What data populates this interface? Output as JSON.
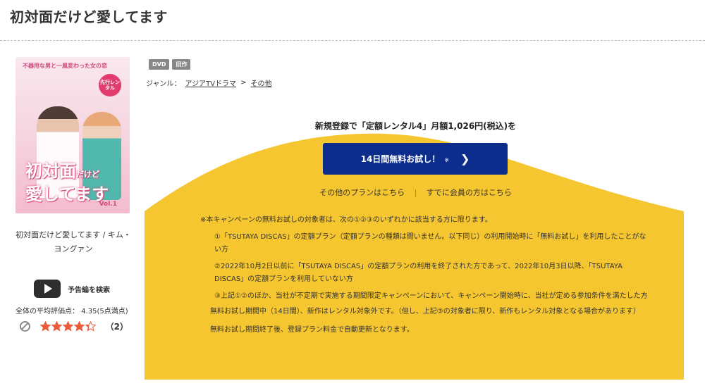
{
  "page": {
    "title": "初対面だけど愛してます"
  },
  "poster": {
    "top_text": "不器用な男と一風変わった女の恋",
    "badge": "先行レンタル",
    "title_line1": "初対面",
    "title_small": "だけど",
    "title_line2": "愛してます",
    "vol": "Vol.1"
  },
  "item": {
    "caption": "初対面だけど愛してます / キム・ヨングァン",
    "trailer_label": "予告編を検索",
    "avg_rating": "全体の平均評価点： 4.35(5点満点)",
    "rating": 4.35,
    "review_count": "（2）"
  },
  "tags": [
    "DVD",
    "旧作"
  ],
  "genre": {
    "label": "ジャンル：",
    "items": [
      "アジアTVドラマ",
      "その他"
    ],
    "sep": ">"
  },
  "promo": {
    "headline": "新規登録で「定額レンタル4」月額1,026円(税込)を",
    "button_label": "14日間無料お試し！",
    "button_mark": "※",
    "button_chevron": "❯",
    "other_plans": "その他のプランはこちら",
    "link_sep": "|",
    "member_link": "すでに会員の方はこちら"
  },
  "notes": {
    "intro": "※本キャンペーンの無料お試しの対象者は、次の①②③のいずれかに該当する方に限ります。",
    "conditions": [
      "①「TSUTAYA DISCAS」の定額プラン（定額プランの種類は問いません。以下同じ）の利用開始時に「無料お試し」を利用したことがない方",
      "②2022年10月2日以前に「TSUTAYA DISCAS」の定額プランの利用を終了された方であって、2022年10月3日以降、「TSUTAYA DISCAS」の定額プランを利用していない方",
      "③上記①②のほか、当社が不定期で実施する期間限定キャンペーンにおいて、キャンペーン開始時に、当社が定める参加条件を満たした方"
    ],
    "after": "無料お試し期間中（14日間）、新作はレンタル対象外です。（但し、上記③の対象者に限り、新作もレンタル対象となる場合があります）",
    "last": "無料お試し期間終了後、登録プラン料金で自動更新となります。"
  },
  "colors": {
    "wave": "#f6c631",
    "button": "#0d2d8c",
    "star": "#ec5a37"
  }
}
